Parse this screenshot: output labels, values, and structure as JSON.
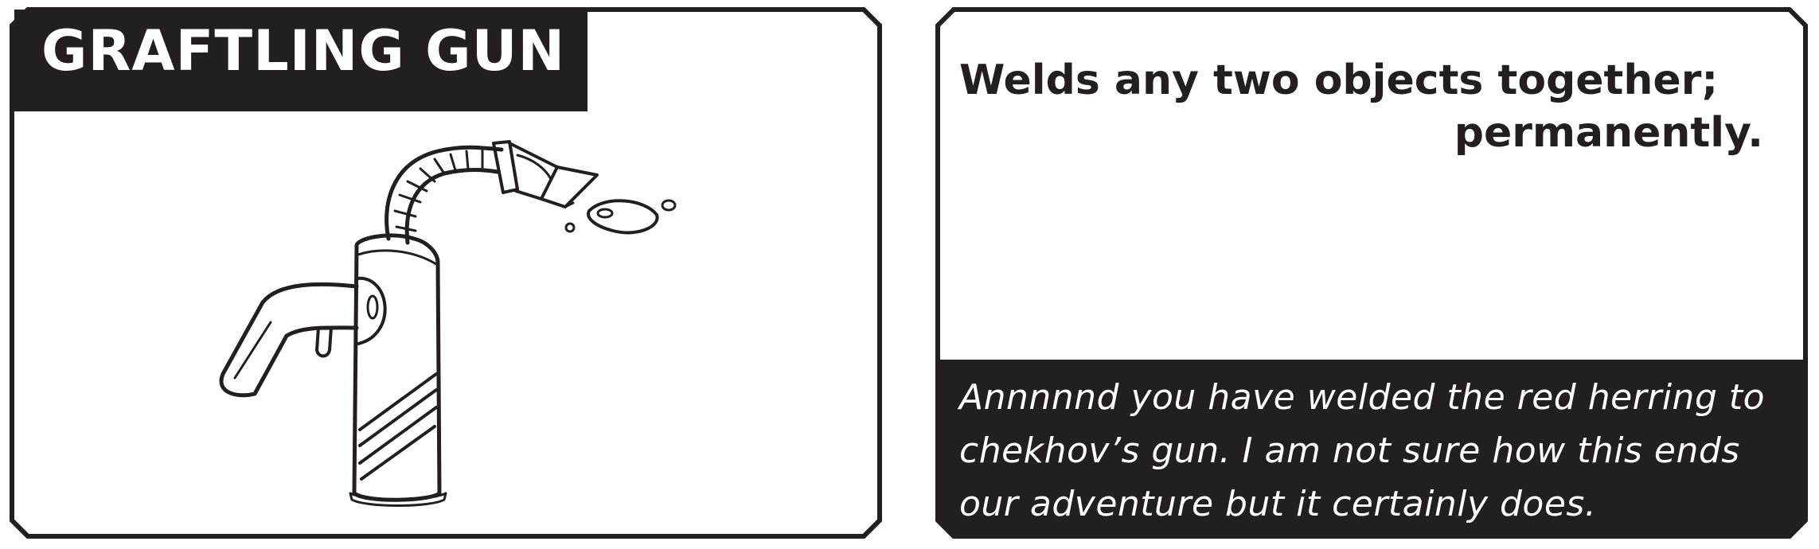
{
  "card": {
    "title": "GRAFTLING GUN",
    "effect_line1": "Welds any two objects together;",
    "effect_line2": "permanently.",
    "flavor_text": "Annnnnd you have welded the red herring to chekhov’s gun. I am not sure how this ends our adventure but it certainly does.",
    "illustration": "graftling-gun-sketch"
  },
  "colors": {
    "ink": "#231f20",
    "paper": "#ffffff"
  }
}
